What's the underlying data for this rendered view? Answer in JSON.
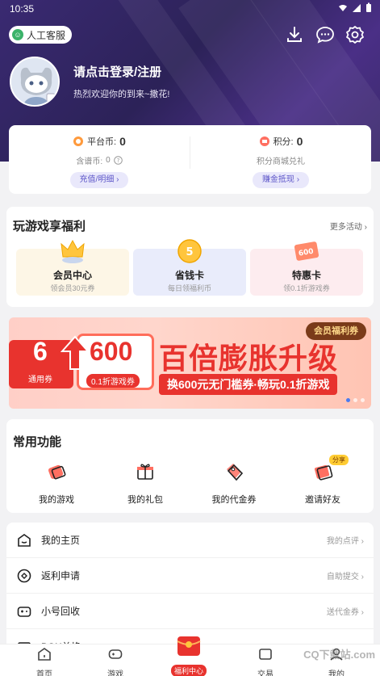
{
  "status_bar": {
    "time": "10:35"
  },
  "header": {
    "service_label": "人工客服",
    "login_title": "请点击登录/注册",
    "login_subtitle": "热烈欢迎你的到来~撒花!"
  },
  "coins": {
    "platform_label": "平台币:",
    "platform_value": "0",
    "reserve_label": "含谱币:",
    "reserve_value": "0",
    "recharge_button": "充值/明细",
    "points_label": "积分:",
    "points_value": "0",
    "points_sub": "积分商城兑礼",
    "earn_button": "赚金抵现"
  },
  "welfare": {
    "title": "玩游戏享福利",
    "more": "更多活动",
    "items": [
      {
        "title": "会员中心",
        "sub": "领会员30元券",
        "bg": "#fdf6e6"
      },
      {
        "title": "省钱卡",
        "sub": "每日领福利币",
        "bg": "#e9ecfb",
        "badge": "5"
      },
      {
        "title": "特惠卡",
        "sub": "领0.1折游戏券",
        "bg": "#fdecef",
        "badge": "600"
      }
    ]
  },
  "banner": {
    "badge": "会员福利券",
    "num_left": "6",
    "tag_left": "通用券",
    "num_right": "600",
    "tag_right": "0.1折游戏券",
    "headline": "百倍膨胀升级",
    "subline": "换600元无门槛券·畅玩0.1折游戏"
  },
  "functions": {
    "title": "常用功能",
    "items": [
      {
        "label": "我的游戏"
      },
      {
        "label": "我的礼包"
      },
      {
        "label": "我的代金券"
      },
      {
        "label": "邀请好友",
        "tag": "分享"
      }
    ]
  },
  "list": [
    {
      "label": "我的主页",
      "right": "我的点评"
    },
    {
      "label": "返利申请",
      "right": "自助提交"
    },
    {
      "label": "小号回收",
      "right": "送代金券"
    },
    {
      "label": "BOX兑换",
      "right": ""
    }
  ],
  "tabbar": {
    "tabs": [
      {
        "label": "首页"
      },
      {
        "label": "游戏"
      },
      {
        "label": "福利中心"
      },
      {
        "label": "交易"
      },
      {
        "label": "我的"
      }
    ]
  },
  "watermark": "CQ下载站.com",
  "colors": {
    "accent": "#e8332e",
    "hero": "#3a2a72",
    "pill": "#5e57c9"
  }
}
